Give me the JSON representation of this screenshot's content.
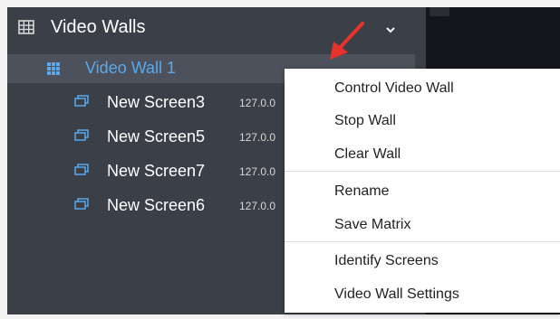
{
  "sidebar": {
    "title": "Video Walls",
    "wall": {
      "label": "Video Wall 1"
    },
    "screens": [
      {
        "name": "New Screen3",
        "ip": "127.0.0"
      },
      {
        "name": "New Screen5",
        "ip": "127.0.0"
      },
      {
        "name": "New Screen7",
        "ip": "127.0.0"
      },
      {
        "name": "New Screen6",
        "ip": "127.0.0"
      }
    ]
  },
  "context_menu": {
    "items": [
      "Control Video Wall",
      "Stop Wall",
      "Clear Wall",
      "Rename",
      "Save Matrix",
      "Identify Screens",
      "Video Wall Settings"
    ]
  },
  "colors": {
    "panel": "#3b3f47",
    "selected_row": "#4c515b",
    "accent_blue": "#5aa9ec",
    "arrow_red": "#e8332a",
    "menu_bg": "#ffffff"
  },
  "icons": {
    "header": "video-wall-icon",
    "wall": "grid-icon",
    "screen": "monitor-icon",
    "expand": "chevron-down-icon",
    "annotation": "red-arrow-icon"
  }
}
